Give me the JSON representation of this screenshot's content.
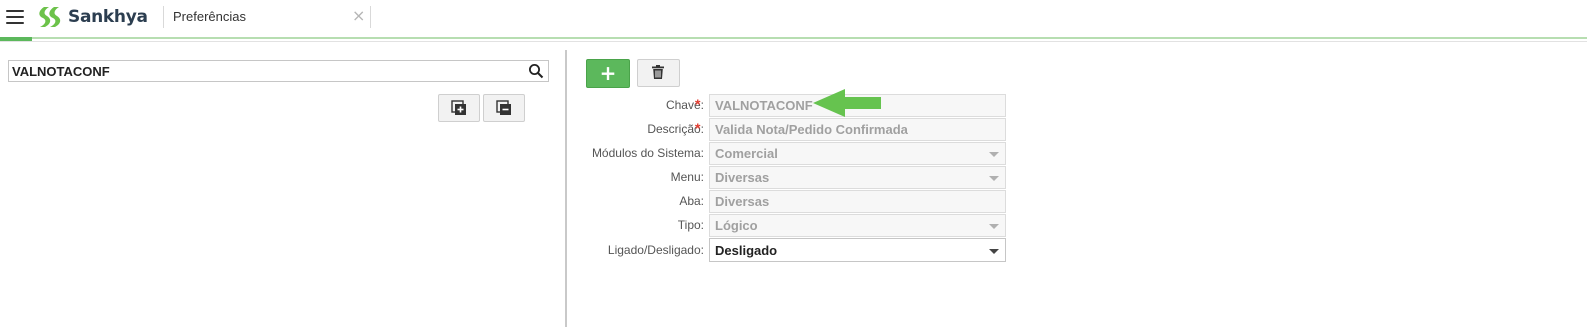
{
  "app": {
    "brand": "Sankhya"
  },
  "tabs": [
    {
      "label": "Preferências",
      "close": "×"
    }
  ],
  "left_panel": {
    "search": {
      "value": "VALNOTACONF"
    }
  },
  "form": {
    "fields": [
      {
        "label": "Chave:",
        "value": "VALNOTACONF",
        "required": true,
        "type": "text",
        "editable": false
      },
      {
        "label": "Descrição:",
        "value": "Valida Nota/Pedido Confirmada",
        "required": true,
        "type": "text",
        "editable": false
      },
      {
        "label": "Módulos do Sistema:",
        "value": "Comercial",
        "required": false,
        "type": "select",
        "editable": false
      },
      {
        "label": "Menu:",
        "value": "Diversas",
        "required": false,
        "type": "select",
        "editable": false
      },
      {
        "label": "Aba:",
        "value": "Diversas",
        "required": false,
        "type": "text",
        "editable": false
      },
      {
        "label": "Tipo:",
        "value": "Lógico",
        "required": false,
        "type": "select",
        "editable": false
      },
      {
        "label": "Ligado/Desligado:",
        "value": "Desligado",
        "required": false,
        "type": "select",
        "editable": true
      }
    ],
    "required_marker": "*"
  },
  "colors": {
    "accent_green": "#5cb85c",
    "required_red": "#e23a2e",
    "annotation_arrow": "#66c34f"
  },
  "icons": {
    "menu": "hamburger-menu-icon",
    "search": "search-icon",
    "add": "plus-icon",
    "delete": "trash-icon",
    "expand": "expand-all-icon",
    "collapse": "collapse-all-icon"
  }
}
